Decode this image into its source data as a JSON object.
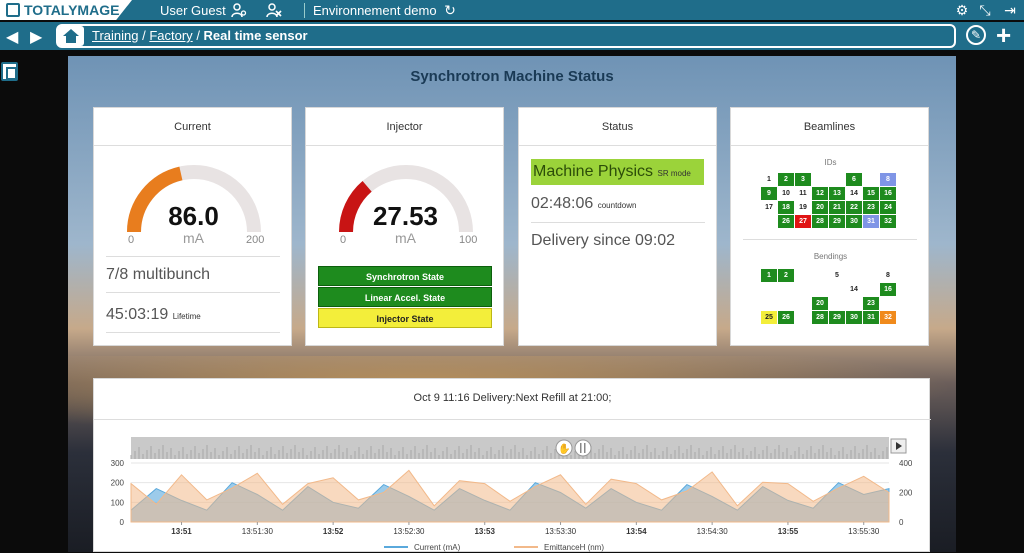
{
  "app": {
    "brand": "TOTALYMAGE",
    "user": "User Guest",
    "environment": "Environnement demo"
  },
  "icons": {
    "topbar_left": [
      "user-settings-icon",
      "user-remove-icon",
      "refresh-icon"
    ],
    "topbar_right": [
      "gear-icon",
      "collapse-icon",
      "logout-icon"
    ],
    "navbar": [
      "back-arrow-icon",
      "forward-arrow-icon",
      "home-icon",
      "edit-icon",
      "plus-icon"
    ],
    "sidebar": [
      "dashboard-icon"
    ]
  },
  "breadcrumb": {
    "items": [
      "Training",
      "Factory"
    ],
    "current": "Real time sensor"
  },
  "dashboard": {
    "title": "Synchrotron Machine Status",
    "current": {
      "title": "Current",
      "value": "86.0",
      "unit": "mA",
      "min": "0",
      "max": "200",
      "fraction": 0.43,
      "multibunch": "7/8 multibunch",
      "lifetime": "45:03:19",
      "lifetime_label": "Lifetime"
    },
    "injector": {
      "title": "Injector",
      "value": "27.53",
      "unit": "mA",
      "min": "0",
      "max": "100",
      "fraction": 0.2753,
      "states": [
        {
          "label": "Synchrotron State",
          "color": "#1e8b1e"
        },
        {
          "label": "Linear Accel. State",
          "color": "#1e8b1e"
        },
        {
          "label": "Injector State",
          "color": "#f3ee3a"
        }
      ]
    },
    "status": {
      "title": "Status",
      "mode_main": "Machine Physics",
      "mode_sub": "SR mode",
      "countdown": "02:48:06",
      "countdown_label": "countdown",
      "delivery": "Delivery since 09:02"
    },
    "beamlines": {
      "title": "Beamlines",
      "ids_label": "IDs",
      "bendings_label": "Bendings",
      "ids": [
        [
          "1",
          "w"
        ],
        [
          "2",
          "g"
        ],
        [
          "3",
          "g"
        ],
        [
          "",
          "e"
        ],
        [
          "",
          "e"
        ],
        [
          "6",
          "g"
        ],
        [
          "",
          "e"
        ],
        [
          "8",
          "b"
        ],
        [
          "9",
          "g"
        ],
        [
          "10",
          "w"
        ],
        [
          "11",
          "w"
        ],
        [
          "12",
          "g"
        ],
        [
          "13",
          "g"
        ],
        [
          "14",
          "w"
        ],
        [
          "15",
          "g"
        ],
        [
          "16",
          "g"
        ],
        [
          "17",
          "w"
        ],
        [
          "18",
          "g"
        ],
        [
          "19",
          "w"
        ],
        [
          "20",
          "g"
        ],
        [
          "21",
          "g"
        ],
        [
          "22",
          "g"
        ],
        [
          "23",
          "g"
        ],
        [
          "24",
          "g"
        ],
        [
          "",
          "e"
        ],
        [
          "26",
          "g"
        ],
        [
          "27",
          "r"
        ],
        [
          "28",
          "g"
        ],
        [
          "29",
          "g"
        ],
        [
          "30",
          "g"
        ],
        [
          "31",
          "b"
        ],
        [
          "32",
          "g"
        ]
      ],
      "bendings": [
        [
          "1",
          "g"
        ],
        [
          "2",
          "g"
        ],
        [
          "",
          "e"
        ],
        [
          "",
          "e"
        ],
        [
          "5",
          "w"
        ],
        [
          "",
          "e"
        ],
        [
          "",
          "e"
        ],
        [
          "8",
          "w"
        ],
        [
          "",
          "e"
        ],
        [
          "",
          "e"
        ],
        [
          "",
          "e"
        ],
        [
          "",
          "e"
        ],
        [
          "",
          "e"
        ],
        [
          "14",
          "w"
        ],
        [
          "",
          "e"
        ],
        [
          "16",
          "g"
        ],
        [
          "",
          "e"
        ],
        [
          "",
          "e"
        ],
        [
          "",
          "e"
        ],
        [
          "20",
          "g"
        ],
        [
          "",
          "e"
        ],
        [
          "",
          "e"
        ],
        [
          "23",
          "g"
        ],
        [
          "",
          "e"
        ],
        [
          "25",
          "y"
        ],
        [
          "26",
          "g"
        ],
        [
          "",
          "e"
        ],
        [
          "28",
          "g"
        ],
        [
          "29",
          "g"
        ],
        [
          "30",
          "g"
        ],
        [
          "31",
          "g"
        ],
        [
          "32",
          "o"
        ]
      ]
    }
  },
  "chart_panel": {
    "title": "Oct 9 11:16 Delivery:Next Refill at 21:00;"
  },
  "chart_data": {
    "type": "area",
    "x": [
      "13:50:40",
      "13:50:50",
      "13:51",
      "13:51:10",
      "13:51:20",
      "13:51:30",
      "13:51:40",
      "13:51:50",
      "13:52",
      "13:52:10",
      "13:52:20",
      "13:52:30",
      "13:52:40",
      "13:52:50",
      "13:53",
      "13:53:10",
      "13:53:20",
      "13:53:30",
      "13:53:40",
      "13:53:50",
      "13:54",
      "13:54:10",
      "13:54:20",
      "13:54:30",
      "13:54:40",
      "13:54:50",
      "13:55",
      "13:55:10",
      "13:55:20",
      "13:55:30",
      "13:55:40"
    ],
    "x_ticks": [
      "13:51",
      "13:51:30",
      "13:52",
      "13:52:30",
      "13:53",
      "13:53:30",
      "13:54",
      "13:54:30",
      "13:55",
      "13:55:30"
    ],
    "series": [
      {
        "name": "Current (mA)",
        "axis": "left",
        "color": "#5aa9dc",
        "values": [
          60,
          170,
          110,
          60,
          200,
          140,
          60,
          180,
          100,
          70,
          190,
          130,
          60,
          170,
          110,
          60,
          200,
          150,
          70,
          170,
          100,
          60,
          190,
          130,
          60,
          180,
          110,
          70,
          200,
          140,
          170
        ]
      },
      {
        "name": "EmittanceH (nm)",
        "axis": "right",
        "color": "#f2b98a",
        "values": [
          260,
          120,
          320,
          150,
          230,
          330,
          120,
          260,
          300,
          150,
          200,
          350,
          110,
          280,
          260,
          140,
          240,
          320,
          120,
          290,
          260,
          150,
          210,
          340,
          110,
          270,
          260,
          140,
          230,
          310,
          200
        ]
      }
    ],
    "y_left": {
      "range": [
        0,
        300
      ],
      "ticks": [
        "0",
        "100",
        "200",
        "300"
      ]
    },
    "y_right": {
      "range": [
        0,
        400
      ],
      "ticks": [
        "0",
        "200",
        "400"
      ]
    },
    "legend": "bottom"
  }
}
